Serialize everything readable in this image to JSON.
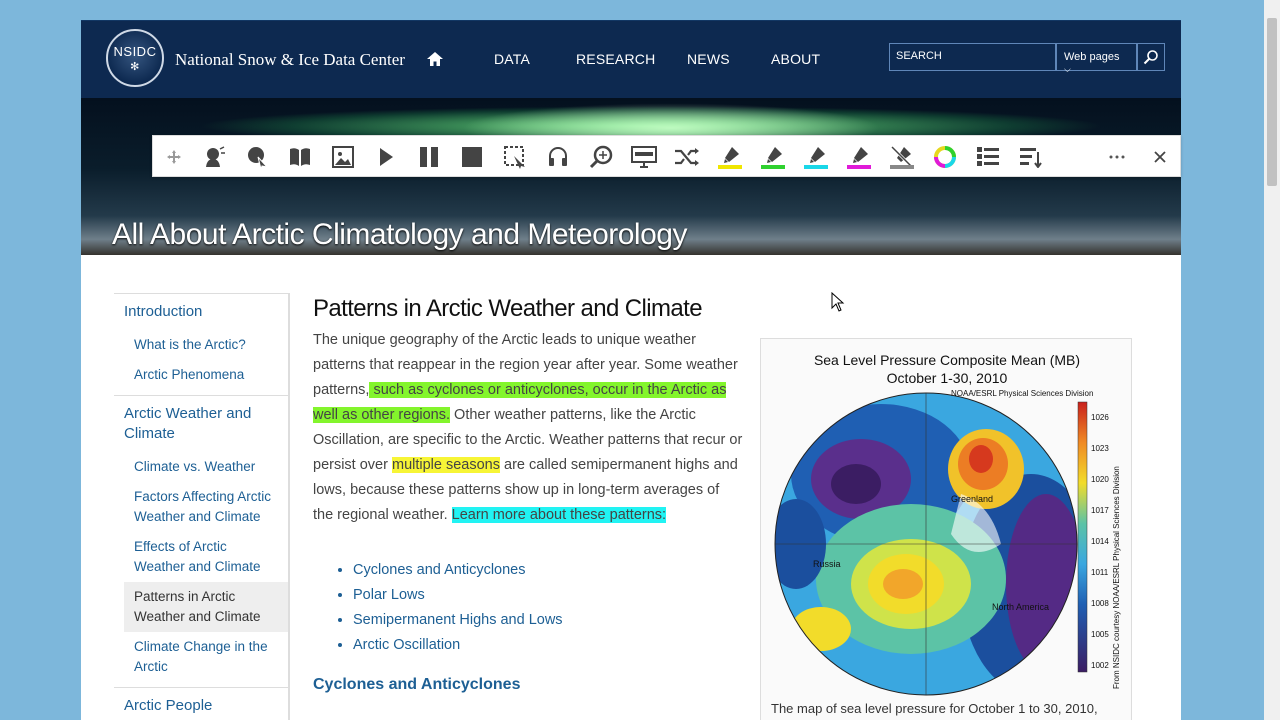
{
  "header": {
    "logo_text": "NSIDC",
    "org_name": "National Snow & Ice Data Center",
    "nav": [
      "DATA",
      "RESEARCH",
      "NEWS",
      "ABOUT"
    ],
    "search_placeholder": "SEARCH",
    "search_scope": "Web pages"
  },
  "banner": {
    "title": "All About Arctic Climatology and Meteorology"
  },
  "toolbar": {
    "icons": [
      "move-icon",
      "speak-icon",
      "click-speak-icon",
      "dictionary-icon",
      "picture-dictionary-icon",
      "play-icon",
      "pause-icon",
      "stop-icon",
      "screenshot-reader-icon",
      "audio-maker-icon",
      "web-search-icon",
      "screen-mask-icon",
      "translator-icon",
      "highlight-yellow-icon",
      "highlight-green-icon",
      "highlight-cyan-icon",
      "highlight-magenta-icon",
      "clear-highlights-icon",
      "vocabulary-icon",
      "collect-highlights-icon",
      "more-icon",
      "close-icon"
    ]
  },
  "sidebar": {
    "items": [
      {
        "label": "Introduction",
        "level": 1
      },
      {
        "label": "What is the Arctic?",
        "level": 2
      },
      {
        "label": "Arctic Phenomena",
        "level": 2
      },
      {
        "label": "Arctic Weather and Climate",
        "level": 1
      },
      {
        "label": "Climate vs. Weather",
        "level": 2
      },
      {
        "label": "Factors Affecting Arctic Weather and Climate",
        "level": 2
      },
      {
        "label": "Effects of Arctic Weather and Climate",
        "level": 2
      },
      {
        "label": "Patterns in Arctic Weather and Climate",
        "level": 2,
        "active": true
      },
      {
        "label": "Climate Change in the Arctic",
        "level": 2
      },
      {
        "label": "Arctic People",
        "level": 1
      }
    ]
  },
  "content": {
    "title": "Patterns in Arctic Weather and Climate",
    "p1": "The unique geography of the Arctic leads to unique weather patterns that reappear in the region year after year. Some weather patterns,",
    "hl_green": " such as cyclones or anticyclones, occur in the Arctic as well as other regions.",
    "p2": " Other weather patterns, like the Arctic Oscillation, are specific to the Arctic. Weather patterns that recur or persist over ",
    "hl_yellow": "multiple seasons",
    "p3": " are called semipermanent highs and lows, because these patterns show up in long-term averages of the regional weather. ",
    "hl_cyan": "Learn more about these patterns:",
    "links": [
      "Cyclones and Anticyclones",
      "Polar Lows",
      "Semipermanent Highs and Lows",
      "Arctic Oscillation"
    ],
    "subheading": "Cyclones and Anticyclones"
  },
  "figure": {
    "title1": "Sea Level Pressure Composite Mean (MB)",
    "title2": "October 1-30, 2010",
    "org_label": "NOAA/ESRL Physical Sciences Division",
    "side_label": "From NSIDC courtesy NOAA/ESRL Physical Sciences Division",
    "scale": [
      "1026",
      "1023",
      "1020",
      "1017",
      "1014",
      "1011",
      "1008",
      "1005",
      "1002"
    ],
    "labels": [
      "Greenland",
      "Russia",
      "North America"
    ],
    "caption": "The map of sea level pressure for October 1 to 30, 2010,"
  }
}
